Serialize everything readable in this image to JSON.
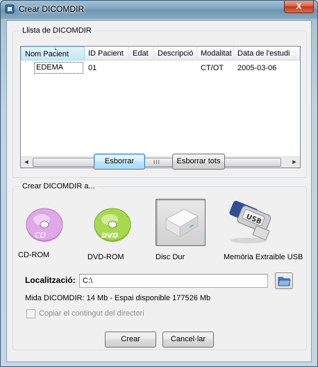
{
  "window": {
    "title": "Crear DICOMDIR",
    "close_symbol": "X"
  },
  "list_group": {
    "title": "Llista de DICOMDIR",
    "columns": [
      "Nom Pacient",
      "ID Pacient",
      "Edat",
      "Descripció",
      "Modalitat",
      "Data de l'estudi"
    ],
    "rows": [
      {
        "name": "EDEMA",
        "id": "01",
        "age": "",
        "description": "",
        "modality": "CT/OT",
        "date": "2005-03-06"
      }
    ],
    "scroll_grip": "III",
    "scroll_left": "◀",
    "scroll_right": "▶"
  },
  "buttons": {
    "delete": "Esborrar",
    "delete_all": "Esborrar tots",
    "create": "Crear",
    "cancel": "Cancel·lar"
  },
  "create_group": {
    "title": "Crear DICOMDIR a...",
    "devices": [
      {
        "label": "CD-ROM",
        "icon": "cd-icon",
        "selected": false
      },
      {
        "label": "DVD-ROM",
        "icon": "dvd-icon",
        "selected": false
      },
      {
        "label": "Disc Dur",
        "icon": "hard-disk-icon",
        "selected": true
      },
      {
        "label": "Memòria Extraible USB",
        "icon": "usb-drive-icon",
        "selected": false
      }
    ],
    "location_label": "Localització:",
    "location_value": "C:\\",
    "size_info": "Mida DICOMDIR: 14 Mb - Espai disponible 177526 Mb",
    "copy_checkbox_label": "Copiar el contingut del directori",
    "copy_checked": false
  },
  "colors": {
    "cd_disc": "#e0a8e8",
    "dvd_disc": "#a8d850",
    "default_button_border": "#3c7fb1"
  }
}
